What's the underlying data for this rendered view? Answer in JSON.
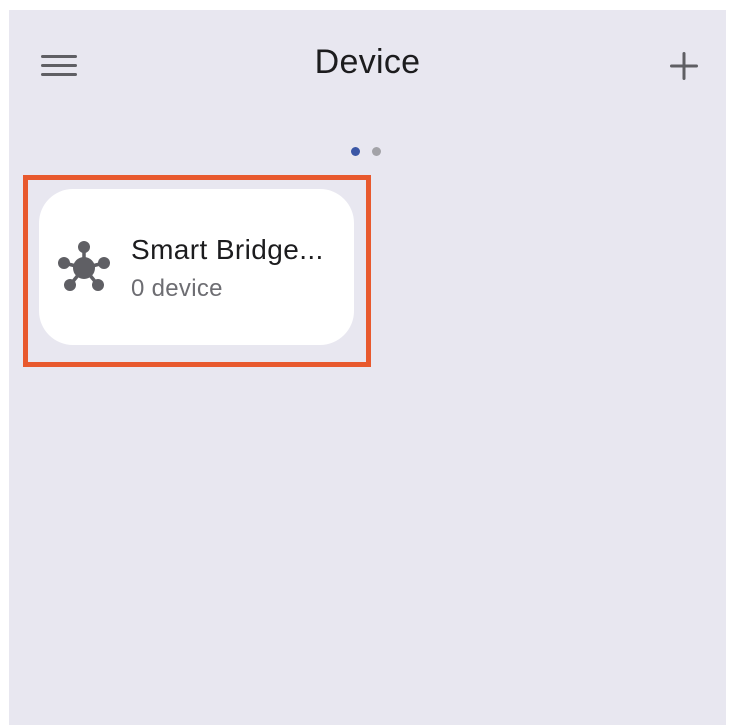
{
  "header": {
    "title": "Device",
    "menu_icon": "hamburger-menu-icon",
    "add_icon": "plus-icon"
  },
  "pager": {
    "pages": 2,
    "active_index": 0,
    "active_color": "#3b57a6",
    "inactive_color": "#a3a3a8"
  },
  "devices": [
    {
      "name": "Smart Bridge...",
      "count_label": "0 device",
      "icon": "hub-network-icon"
    }
  ],
  "colors": {
    "background": "#e8e7f0",
    "card": "#ffffff",
    "highlight": "#e8592e",
    "icon": "#5f5f64"
  }
}
